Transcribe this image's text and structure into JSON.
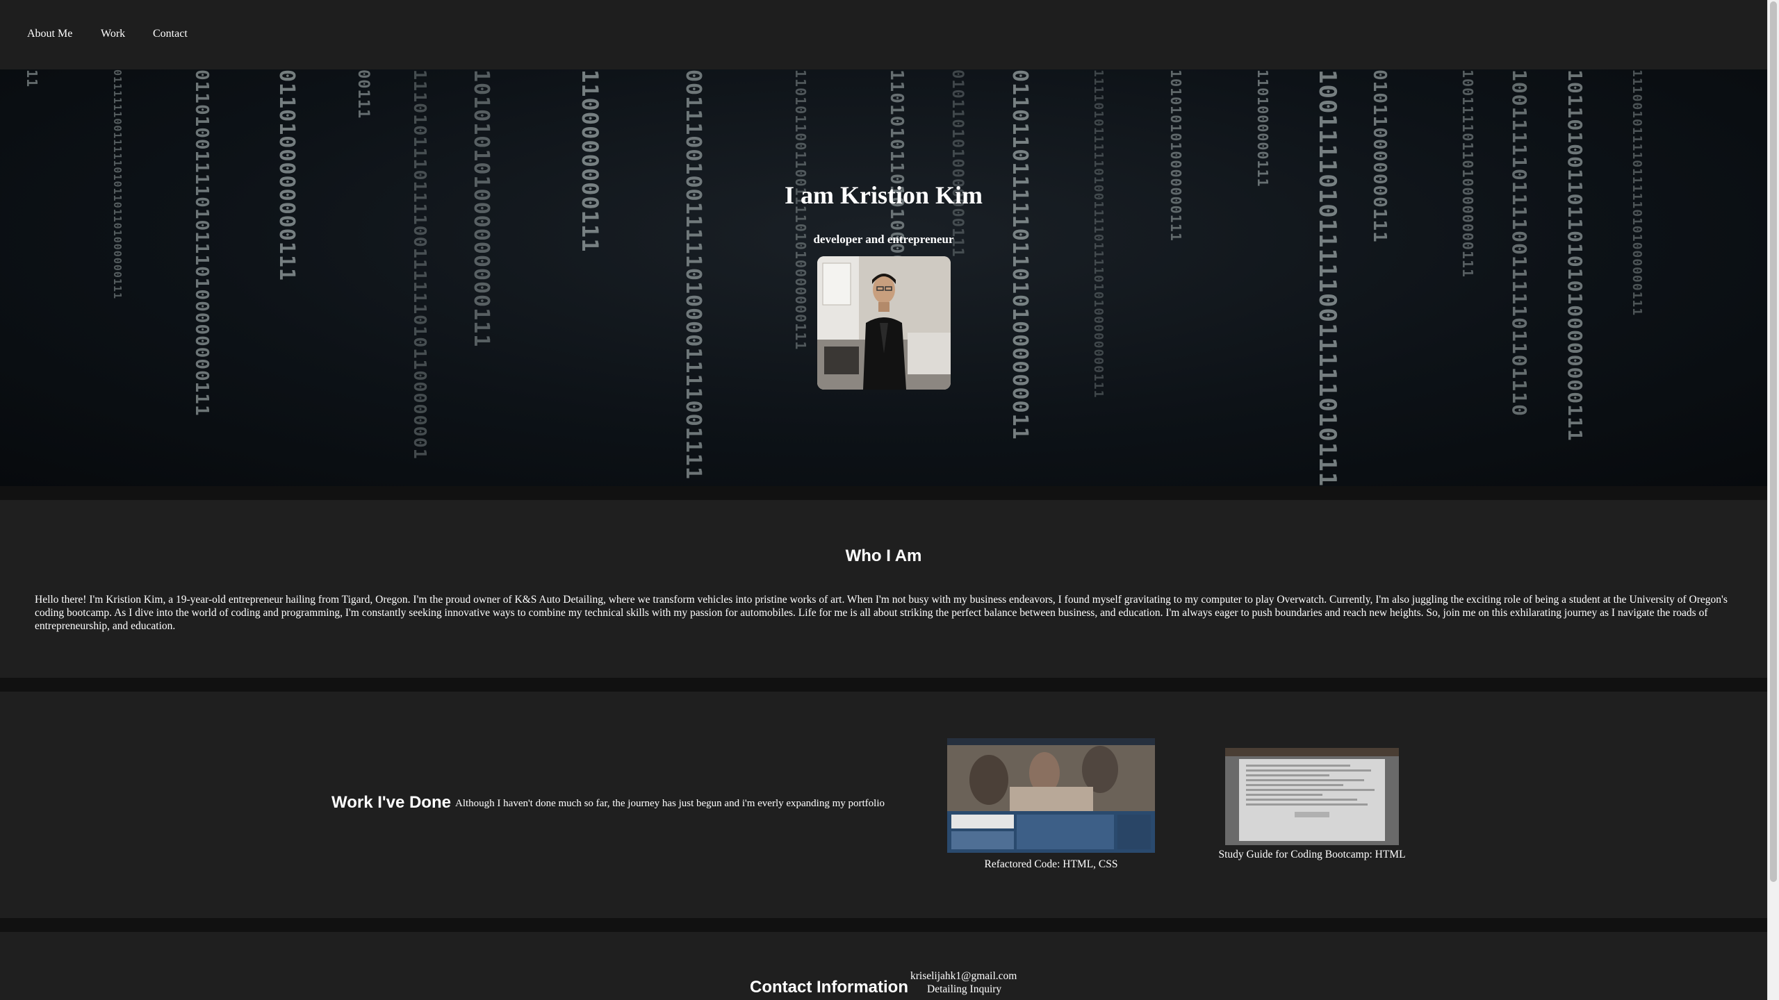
{
  "nav": {
    "items": [
      {
        "label": "About Me"
      },
      {
        "label": "Work"
      },
      {
        "label": "Contact"
      }
    ]
  },
  "hero": {
    "title": "I am Kristion Kim",
    "subtitle": "developer and entrepreneur",
    "rain_columns": [
      "11",
      "011111100111110101101101000000111",
      "011010011110101110100000000111",
      "0110100000000111",
      "00111",
      "11101011101111001111110101100000001",
      "101010101000000000111",
      "1100000000111",
      "0011100100111110100001111001111",
      "1101011001100111101010000000111",
      "110101011010100000000111",
      "0101101010000000111",
      "0110110111110110101000000011",
      "1111010111110100111101111010100000000111",
      "1010101010000000111",
      "1101000000111",
      "1001111010111110011111010111",
      "010110000000111",
      "10011110110100000000111",
      "1001111101111001111101101110",
      "101101001101101010100000000111",
      "111001011110111110101000000111"
    ]
  },
  "about": {
    "heading": "Who I Am",
    "paragraph": "Hello there! I'm Kristion Kim, a 19-year-old entrepreneur hailing from Tigard, Oregon. I'm the proud owner of K&S Auto Detailing, where we transform vehicles into pristine works of art. When I'm not busy with my business endeavors, I found myself gravitating to my computer to play Overwatch. Currently, I'm also juggling the exciting role of being a student at the University of Oregon's coding bootcamp. As I dive into the world of coding and programming, I'm constantly seeking innovative ways to combine my technical skills with my passion for automobiles. Life for me is all about striking the perfect balance between business, and education. I'm always eager to push boundaries and reach new heights. So, join me on this exhilarating journey as I navigate the roads of entrepreneurship, and education."
  },
  "work": {
    "heading": "Work I've Done",
    "description": "Although I haven't done much so far, the journey has just begun and i'm everly expanding my portfolio",
    "projects": [
      {
        "label": "Refactored Code: HTML, CSS"
      },
      {
        "label": "Study Guide for Coding Bootcamp: HTML"
      }
    ]
  },
  "contact": {
    "heading": "Contact Information",
    "email": "kriselijahk1@gmail.com",
    "inquiry": "Detailing Inquiry"
  },
  "colors": {
    "page_bg": "#1f1f1f",
    "band": "#111111",
    "text": "#ffffff",
    "rain": "#aeb9b9"
  }
}
